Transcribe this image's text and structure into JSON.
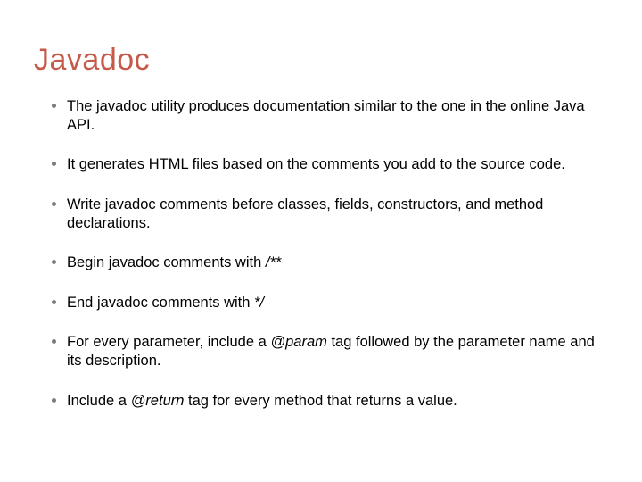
{
  "title": "Javadoc",
  "bullets": {
    "b0": {
      "pre": "The javadoc utility produces documentation similar to the one in the online Java API."
    },
    "b1": {
      "pre": "It generates HTML files based on the comments you add to the source code."
    },
    "b2": {
      "pre": "Write javadoc comments before classes, fields, constructors, and method declarations."
    },
    "b3": {
      "pre": "Begin javadoc comments with ",
      "ital": "/**"
    },
    "b4": {
      "pre": "End javadoc comments with ",
      "ital": "*/"
    },
    "b5": {
      "pre": "For every parameter, include a ",
      "ital": "@param",
      "post": " tag followed by the parameter name and its description."
    },
    "b6": {
      "pre": "Include a ",
      "ital": "@return",
      "post": " tag for every method that returns a value."
    }
  }
}
